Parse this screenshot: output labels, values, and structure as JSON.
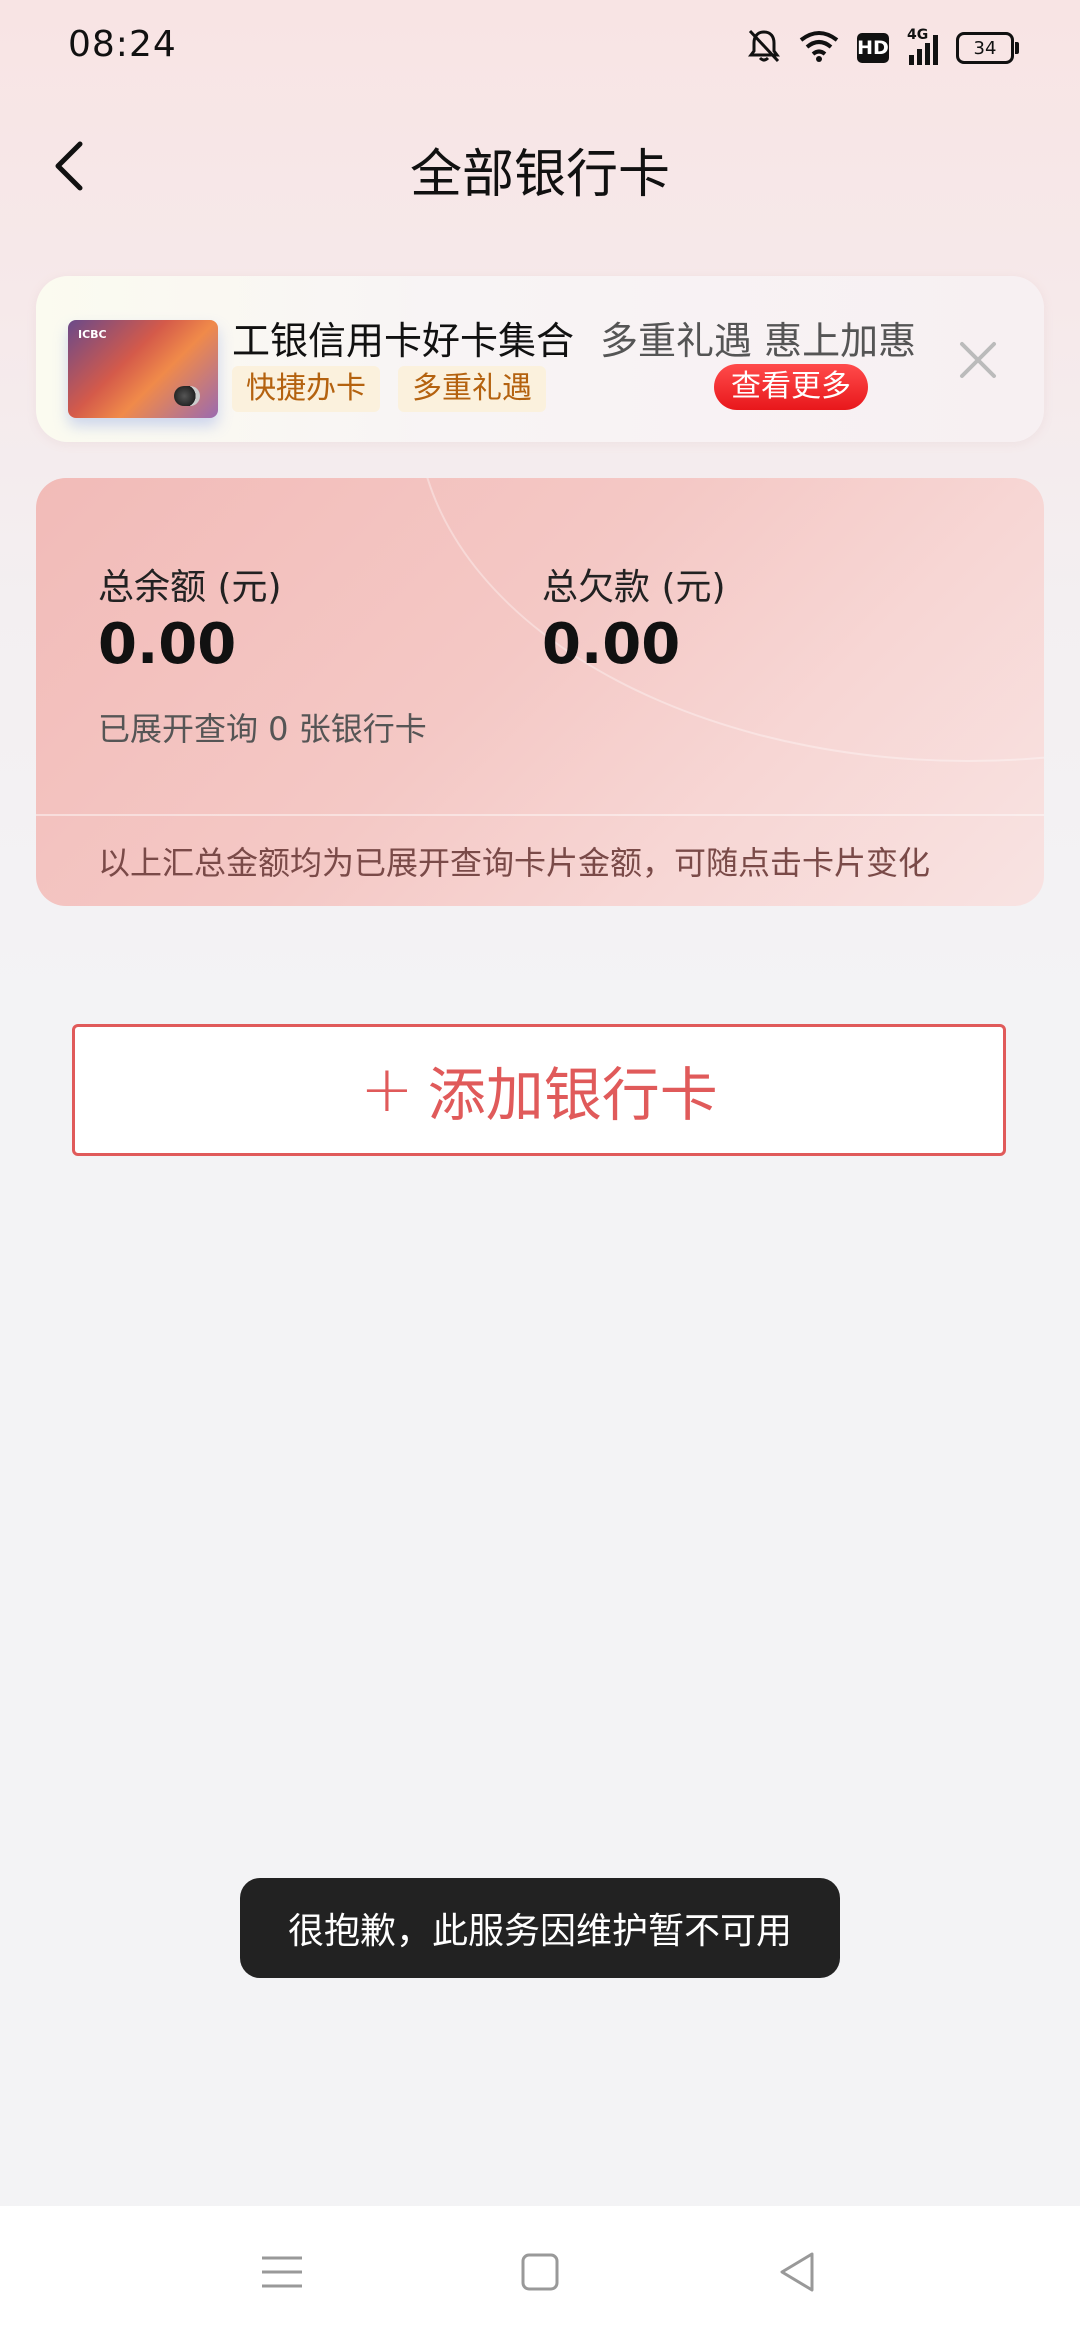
{
  "status_bar": {
    "time": "08:24",
    "hd": "HD",
    "network": "4G",
    "battery": "34",
    "icons": [
      "bell-off-icon",
      "wifi-icon",
      "hd-icon",
      "signal-4g-icon",
      "battery-icon"
    ]
  },
  "header": {
    "title": "全部银行卡",
    "back_icon": "chevron-left-icon"
  },
  "promo": {
    "card_logo": "ICBC",
    "title": "工银信用卡好卡集合",
    "subtitle": "多重礼遇 惠上加惠",
    "tags": [
      "快捷办卡",
      "多重礼遇"
    ],
    "more_label": "查看更多",
    "close_icon": "close-icon"
  },
  "summary": {
    "balance_label": "总余额 (元)",
    "balance_value": "0.00",
    "debt_label": "总欠款 (元)",
    "debt_value": "0.00",
    "count_text": "已展开查询 0 张银行卡",
    "note": "以上汇总金额均为已展开查询卡片金额，可随点击卡片变化"
  },
  "add_card": {
    "icon": "plus-icon",
    "label": "添加银行卡"
  },
  "toast": {
    "message": "很抱歉，此服务因维护暂不可用"
  },
  "nav_bar": {
    "icons": [
      "menu-icon",
      "home-square-icon",
      "back-triangle-icon"
    ]
  },
  "colors": {
    "accent": "#e05a5a",
    "more_button": "#e8171b",
    "tag_text": "#b4620f",
    "tag_bg": "#fbf1dd",
    "toast_bg": "#222222"
  }
}
